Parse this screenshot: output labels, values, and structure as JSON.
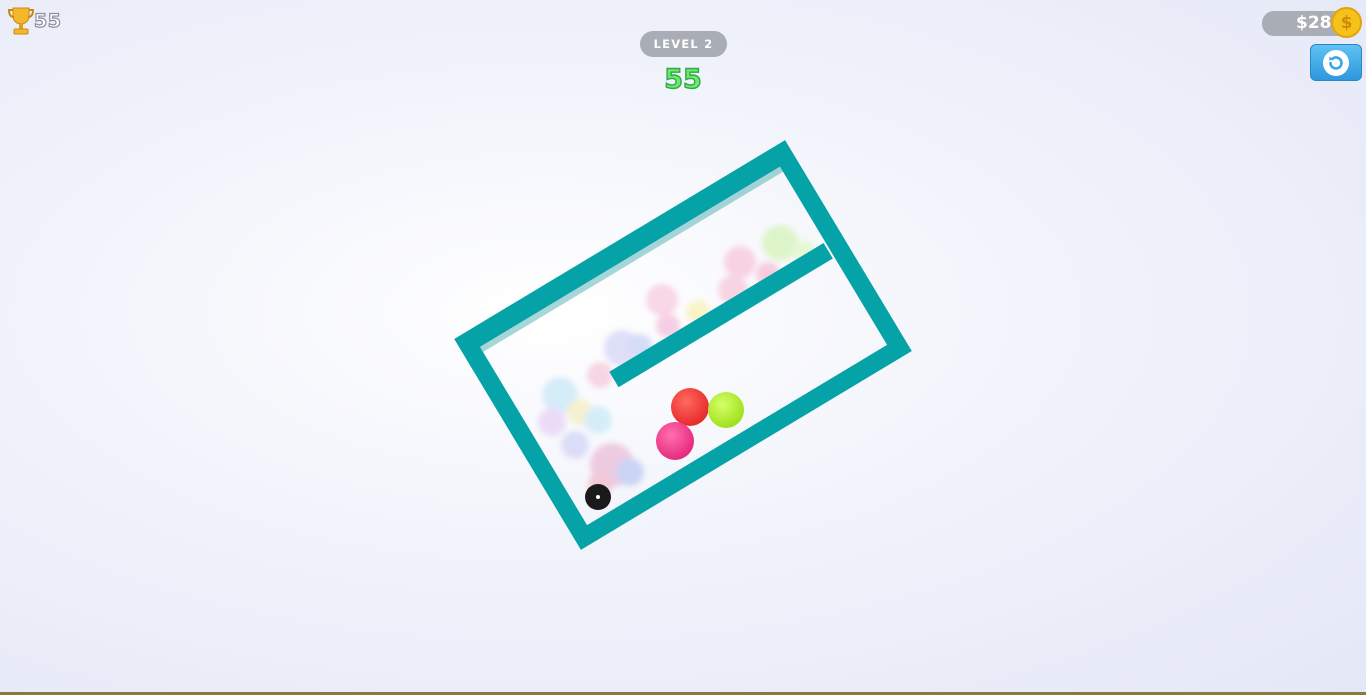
{
  "hud": {
    "trophy_count": "55",
    "level_label": "LEVEL 2",
    "score": "55",
    "money": "$28",
    "coin_symbol": "$"
  },
  "icons": [
    "trophy-icon",
    "coin-icon",
    "restart-icon"
  ],
  "colors": {
    "wall": "#05a3a8",
    "ball_red": "#f0383a",
    "ball_lime": "#b7f02e",
    "ball_pink": "#ee3c8c",
    "hole": "#1a1a1a",
    "score_text": "#6ee86a",
    "restart_button": "#3aa6e8"
  }
}
